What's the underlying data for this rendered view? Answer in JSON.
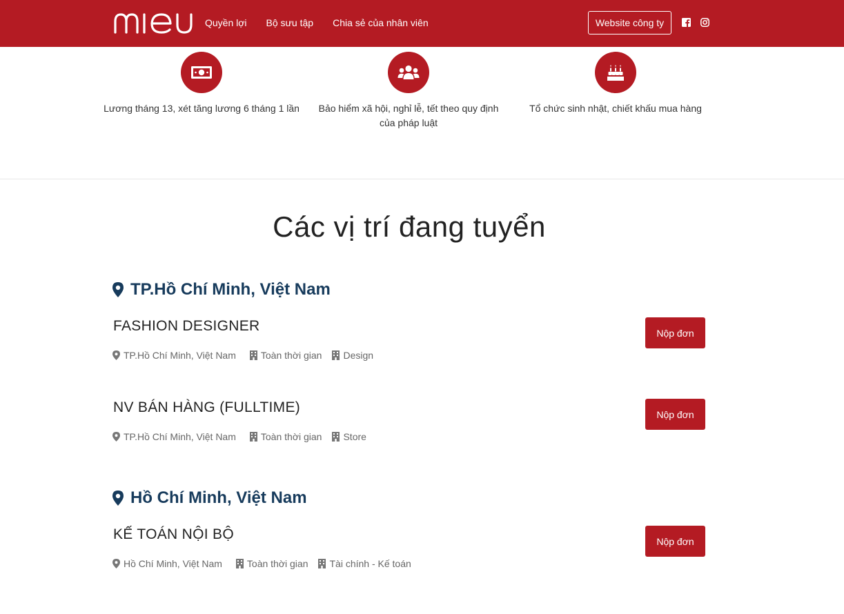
{
  "brand": {
    "logo_text": "mieu",
    "primary_color": "#b41b23",
    "heading_color": "#173b5c"
  },
  "nav": {
    "items": [
      "Quyền lợi",
      "Bộ sưu tập",
      "Chia sẻ của nhân viên"
    ]
  },
  "header": {
    "company_site_label": "Website công ty",
    "social_icons": [
      "facebook-icon",
      "instagram-icon"
    ]
  },
  "benefits": [
    {
      "icon": "money-icon",
      "text": "Lương tháng 13, xét tăng lương 6 tháng 1 lần"
    },
    {
      "icon": "users-icon",
      "text": "Bảo hiểm xã hội, nghỉ lễ, tết theo quy định của pháp luật"
    },
    {
      "icon": "birthday-cake-icon",
      "text": "Tổ chức sinh nhật, chiết khấu mua hàng"
    }
  ],
  "jobs_section": {
    "title": "Các vị trí đang tuyển",
    "groups": [
      {
        "location": "TP.Hồ Chí Minh, Việt Nam",
        "jobs": [
          {
            "title": "FASHION DESIGNER",
            "location": "TP.Hồ Chí Minh, Việt Nam",
            "type": "Toàn thời gian",
            "department": "Design",
            "apply_label": "Nộp đơn"
          },
          {
            "title": "NV BÁN HÀNG (FULLTIME)",
            "location": "TP.Hồ Chí Minh, Việt Nam",
            "type": "Toàn thời gian",
            "department": "Store",
            "apply_label": "Nộp đơn"
          }
        ]
      },
      {
        "location": "Hồ Chí Minh, Việt Nam",
        "jobs": [
          {
            "title": "KẾ TOÁN NỘI BỘ",
            "location": "Hồ Chí Minh, Việt Nam",
            "type": "Toàn thời gian",
            "department": "Tài chính - Kế toán",
            "apply_label": "Nộp đơn"
          }
        ]
      }
    ]
  }
}
